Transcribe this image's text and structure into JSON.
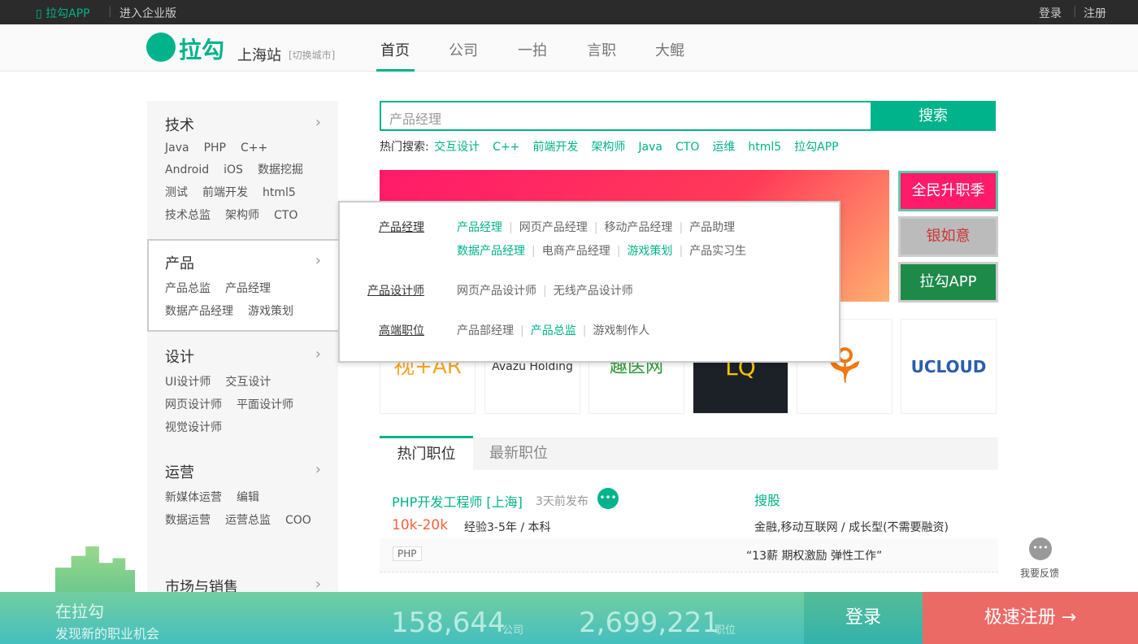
{
  "topbar": {
    "app": "拉勾APP",
    "enterprise": "进入企业版",
    "login": "登录",
    "register": "注册"
  },
  "header": {
    "logo": "拉勾",
    "city": "上海站",
    "switch_city": "[切换城市]",
    "nav": [
      "首页",
      "公司",
      "一拍",
      "言职",
      "大鲲"
    ]
  },
  "sidebar": [
    {
      "title": "技术",
      "links": [
        "Java",
        "PHP",
        "C++",
        "Android",
        "iOS",
        "数据挖掘",
        "测试",
        "前端开发",
        "html5",
        "技术总监",
        "架构师",
        "CTO"
      ]
    },
    {
      "title": "产品",
      "links": [
        "产品总监",
        "产品经理",
        "数据产品经理",
        "游戏策划"
      ]
    },
    {
      "title": "设计",
      "links": [
        "UI设计师",
        "交互设计",
        "网页设计师",
        "平面设计师",
        "视觉设计师"
      ]
    },
    {
      "title": "运营",
      "links": [
        "新媒体运营",
        "编辑",
        "数据运营",
        "运营总监",
        "COO"
      ]
    },
    {
      "title": "市场与销售",
      "links": []
    }
  ],
  "search": {
    "value": "产品经理",
    "button": "搜索",
    "hot_label": "热门搜索:",
    "hot": [
      "交互设计",
      "C++",
      "前端开发",
      "架构师",
      "Java",
      "CTO",
      "运维",
      "html5",
      "拉勾APP"
    ]
  },
  "side_ads": [
    "全民升职季",
    "银如意",
    "拉勾APP"
  ],
  "company_logos": [
    "视+AR",
    "Avazu Holding",
    "趣医网",
    "LQ",
    "",
    "UCLOUD"
  ],
  "popup": [
    {
      "heading": "产品经理",
      "items": [
        {
          "t": "产品经理",
          "hl": true
        },
        {
          "t": "网页产品经理"
        },
        {
          "t": "移动产品经理"
        },
        {
          "t": "产品助理"
        }
      ],
      "items2": [
        {
          "t": "数据产品经理",
          "hl": true
        },
        {
          "t": "电商产品经理"
        },
        {
          "t": "游戏策划",
          "hl": true
        },
        {
          "t": "产品实习生"
        }
      ]
    },
    {
      "heading": "产品设计师",
      "items": [
        {
          "t": "网页产品设计师"
        },
        {
          "t": "无线产品设计师"
        }
      ]
    },
    {
      "heading": "高端职位",
      "items": [
        {
          "t": "产品部经理"
        },
        {
          "t": "产品总监",
          "hl": true
        },
        {
          "t": "游戏制作人"
        }
      ]
    }
  ],
  "tabs": [
    "热门职位",
    "最新职位"
  ],
  "job": {
    "title": "PHP开发工程师 [上海]",
    "time": "3天前发布",
    "company": "搜股",
    "salary": "10k-20k",
    "req": "经验3-5年 / 本科",
    "industry": "金融,移动互联网 / 成长型(不需要融资)",
    "tag": "PHP",
    "benefit": "“13薪 期权激励 弹性工作”"
  },
  "feedback": "我要反馈",
  "footer": {
    "line1": "在拉勾",
    "line2": "发现新的职业机会",
    "companies": "158,644",
    "companies_label": "公司",
    "jobs": "2,699,221",
    "jobs_label": "职位",
    "login": "登录",
    "register": "极速注册 →"
  },
  "colors": {
    "brand": "#00b38a",
    "salary": "#fd5f39"
  }
}
